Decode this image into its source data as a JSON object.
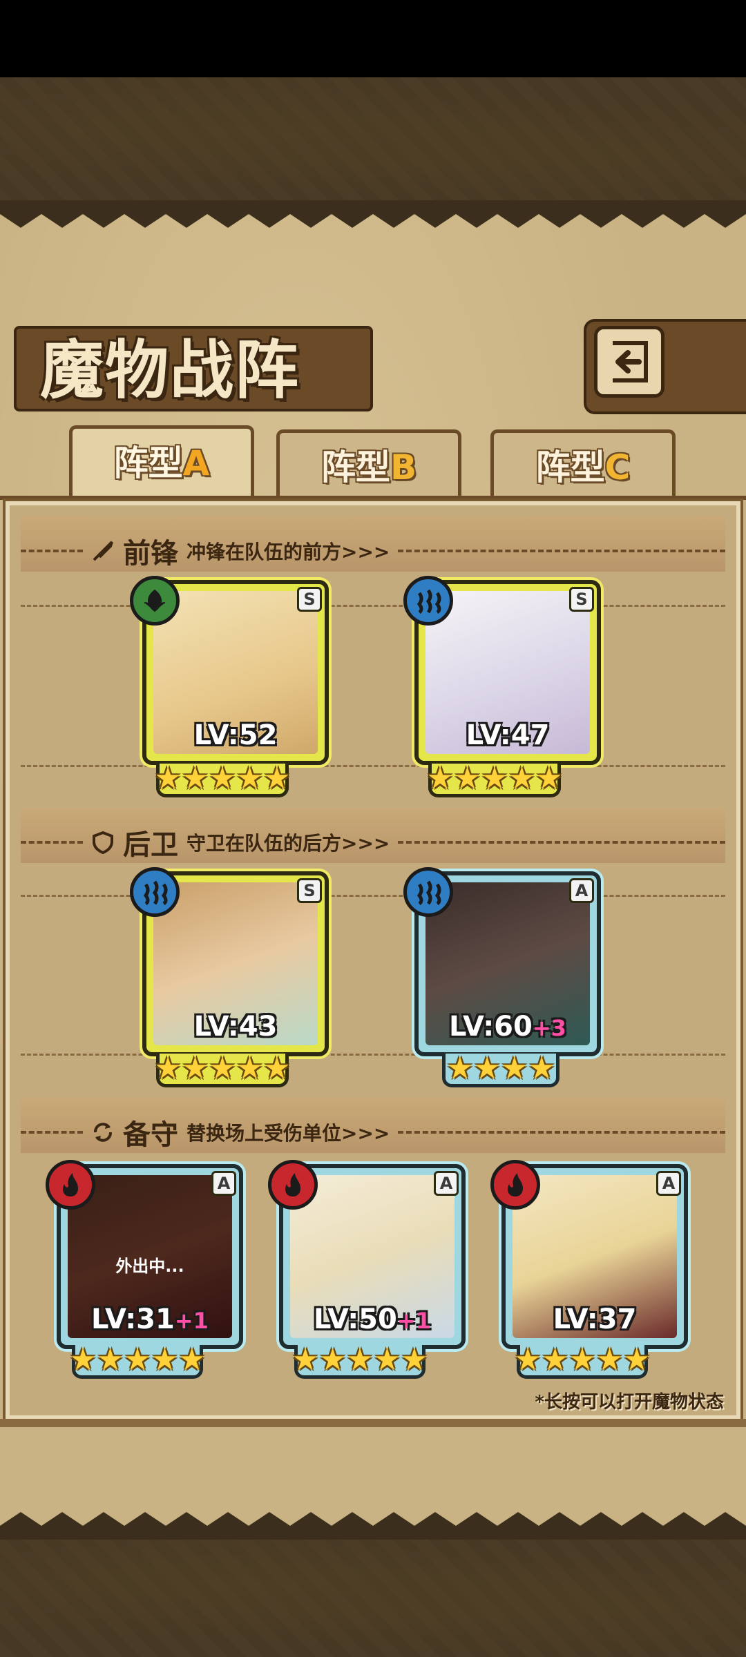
{
  "title": "魔物战阵",
  "tabs": [
    {
      "label": "阵型",
      "suffix": "A",
      "active": true
    },
    {
      "label": "阵型",
      "suffix": "B",
      "active": false
    },
    {
      "label": "阵型",
      "suffix": "C",
      "active": false
    }
  ],
  "sections": {
    "front": {
      "title": "前锋",
      "desc": "冲锋在队伍的前方>>>"
    },
    "back": {
      "title": "后卫",
      "desc": "守卫在队伍的后方>>>"
    },
    "reserve": {
      "title": "备守",
      "desc": "替换场上受伤单位>>>"
    }
  },
  "front_units": [
    {
      "rank": "S",
      "element": "grass",
      "level": "LV:52",
      "bonus": "",
      "stars": "★★★★★"
    },
    {
      "rank": "S",
      "element": "water",
      "level": "LV:47",
      "bonus": "",
      "stars": "★★★★★"
    }
  ],
  "back_units": [
    {
      "rank": "S",
      "element": "water",
      "level": "LV:43",
      "bonus": "",
      "stars": "★★★★★"
    },
    {
      "rank": "A",
      "element": "water",
      "level": "LV:60",
      "bonus": "+3",
      "stars": "★★★★"
    }
  ],
  "reserve_units": [
    {
      "rank": "A",
      "element": "fire",
      "level": "LV:31",
      "bonus": "+1",
      "stars": "★★★★★",
      "status": "外出中..."
    },
    {
      "rank": "A",
      "element": "fire",
      "level": "LV:50",
      "bonus": "+1",
      "stars": "★★★★★",
      "status": ""
    },
    {
      "rank": "A",
      "element": "fire",
      "level": "LV:37",
      "bonus": "",
      "stars": "★★★★★",
      "status": ""
    }
  ],
  "hint": "*长按可以打开魔物状态",
  "colors": {
    "s_frame": "#e5e64a",
    "a_frame": "#9ed7e0",
    "star": "#ffd23a",
    "bonus": "#ff4fa6"
  }
}
